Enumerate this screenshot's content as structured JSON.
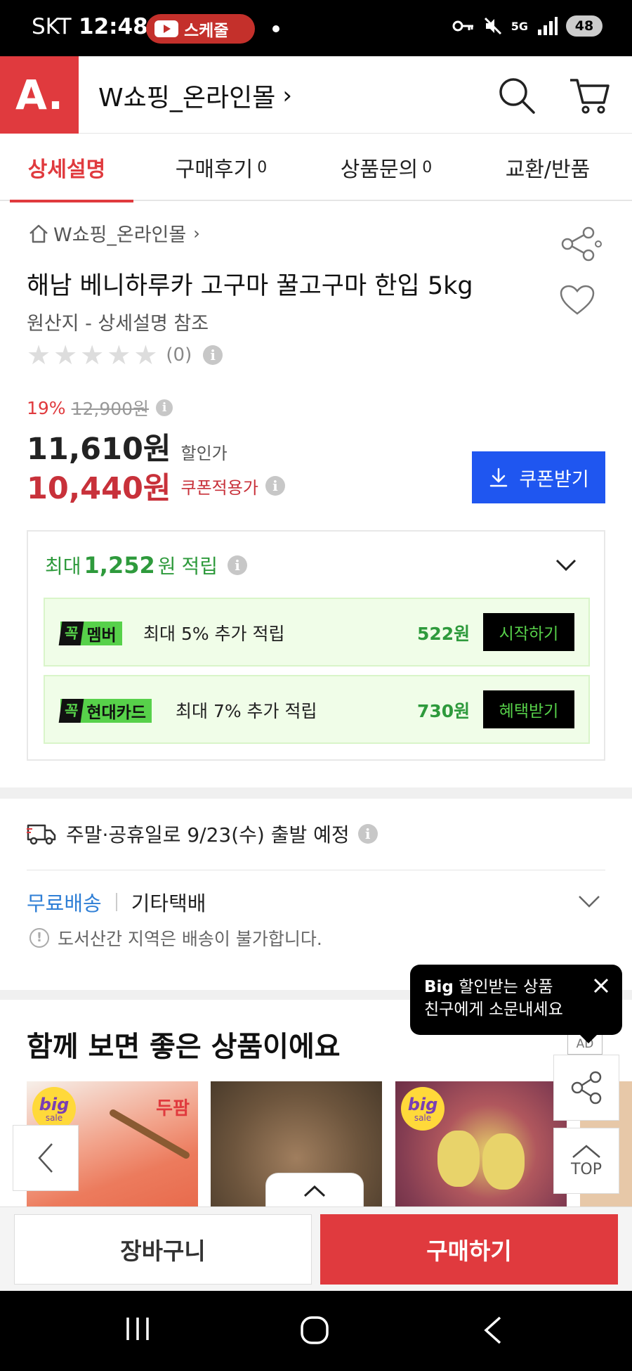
{
  "status_bar": {
    "carrier": "SKT",
    "time": "12:48",
    "youtube_pill": "스케줄",
    "network": "5G",
    "battery": "48"
  },
  "header": {
    "logo": "A.",
    "store_name": "W쇼핑_온라인몰",
    "chevron": "›",
    "icons": [
      "search-icon",
      "cart-icon"
    ]
  },
  "tabs": [
    {
      "label": "상세설명",
      "count": ""
    },
    {
      "label": "구매후기",
      "count": "0"
    },
    {
      "label": "상품문의",
      "count": "0"
    },
    {
      "label": "교환/반품",
      "count": ""
    }
  ],
  "product": {
    "breadcrumb": "W쇼핑_온라인몰",
    "title": "해남 베니하루카 고구마 꿀고구마 한입 5kg",
    "origin": "원산지 - 상세설명 참조",
    "rating_count": "(0)",
    "stars": 0,
    "discount_rate": "19%",
    "original_price": "12,900원",
    "sale_price": "11,610원",
    "sale_label": "할인가",
    "coupon_price": "10,440원",
    "coupon_label": "쿠폰적용가",
    "coupon_button": "쿠폰받기"
  },
  "points": {
    "prefix": "최대",
    "amount": "1,252",
    "unit": "원",
    "suffix": "적립",
    "benefits": [
      {
        "tag_mark": "꼭",
        "tag": "멤버",
        "desc": "최대 5% 추가 적립",
        "amount": "522원",
        "action": "시작하기"
      },
      {
        "tag_mark": "꼭",
        "tag": "현대카드",
        "desc": "최대 7% 추가 적립",
        "amount": "730원",
        "action": "혜택받기"
      }
    ]
  },
  "shipping": {
    "departure": "주말·공휴일로 9/23(수) 출발 예정",
    "free_label": "무료배송",
    "courier": "기타택배",
    "note": "도서산간 지역은 배송이 불가합니다."
  },
  "recommend": {
    "title": "함께 보면 좋은 상품이에요",
    "ad": "AD",
    "badge_big": "big",
    "badge_sale": "sale",
    "dupan": "두팜"
  },
  "popup": {
    "line1_bold": "Big",
    "line1": " 할인받는 상품",
    "line2": "친구에게 소문내세요"
  },
  "floating": {
    "top_label": "TOP"
  },
  "bottom": {
    "cart": "장바구니",
    "buy": "구매하기"
  },
  "colors": {
    "brand_red": "#e03a3e",
    "coupon_blue": "#1f56f0",
    "points_green": "#2e9a3c",
    "shipping_blue": "#2f7fd6"
  }
}
